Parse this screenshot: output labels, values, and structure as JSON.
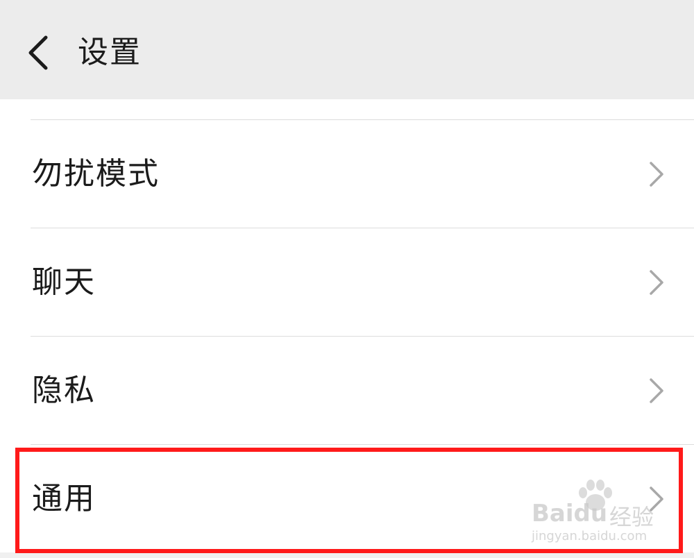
{
  "header": {
    "title": "设置",
    "back_icon": "chevron-left-icon"
  },
  "settings": {
    "items": [
      {
        "label": "勿扰模式",
        "icon": "chevron-right-icon"
      },
      {
        "label": "聊天",
        "icon": "chevron-right-icon"
      },
      {
        "label": "隐私",
        "icon": "chevron-right-icon"
      },
      {
        "label": "通用",
        "icon": "chevron-right-icon",
        "highlighted": true
      }
    ]
  },
  "annotation": {
    "highlight_color": "#ff1a1a"
  },
  "watermark": {
    "brand": "Baidu",
    "brand_cn": "经验",
    "url": "jingyan.baidu.com"
  },
  "colors": {
    "header_bg": "#ececec",
    "text": "#1b1b1b",
    "chevron": "#a8a8a8",
    "divider": "#dcdcdc"
  }
}
